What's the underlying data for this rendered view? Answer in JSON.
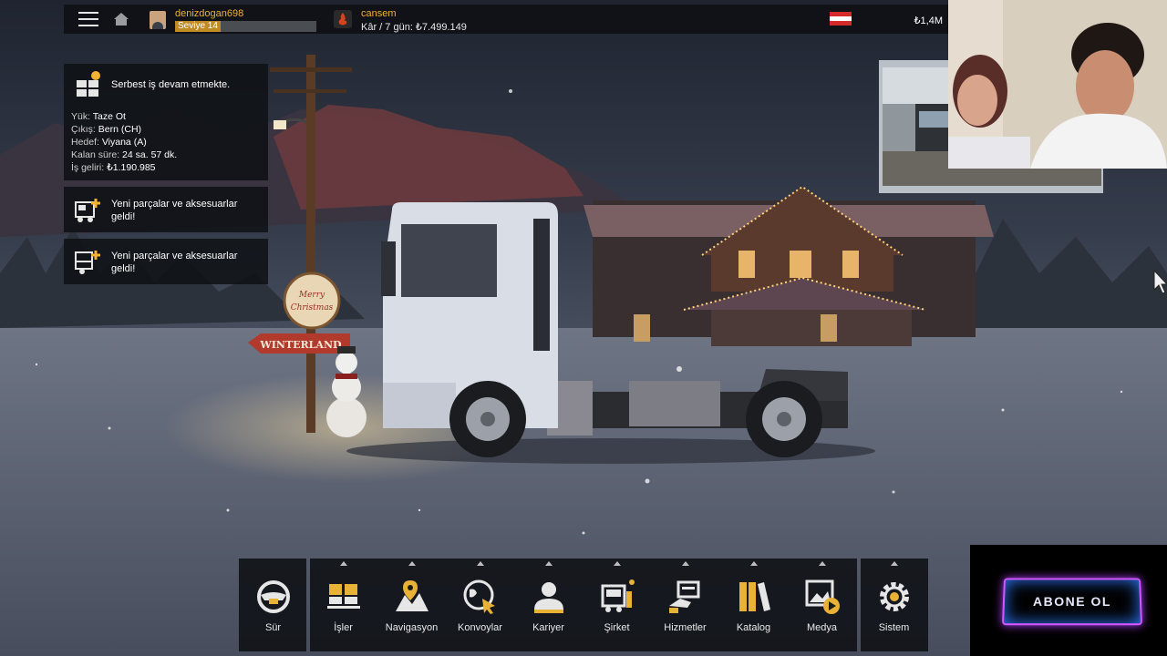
{
  "topbar": {
    "username": "denizdogan698",
    "level_label": "Seviye 14",
    "level_progress": 0.32,
    "company_name": "cansem",
    "company_profit": "Kâr / 7 gün: ₺7.499.149",
    "money": "₺1,4M"
  },
  "job": {
    "title": "Serbest iş devam etmekte.",
    "rows": [
      {
        "label": "Yük:",
        "value": "Taze Ot"
      },
      {
        "label": "Çıkış:",
        "value": "Bern (CH)"
      },
      {
        "label": "Hedef:",
        "value": "Viyana (A)"
      },
      {
        "label": "Kalan süre:",
        "value": "24 sa. 57 dk."
      },
      {
        "label": "İş geliri:",
        "value": "₺1.190.985"
      }
    ]
  },
  "notifications": [
    {
      "text": "Yeni parçalar ve aksesuarlar geldi!"
    },
    {
      "text": "Yeni parçalar ve aksesuarlar geldi!"
    }
  ],
  "scene_signs": {
    "sign_christmas": "Merry Christmas",
    "sign_winterland": "WINTERLAND"
  },
  "toolbar": {
    "items": [
      {
        "label": "Sür",
        "icon": "steering-wheel-icon"
      },
      {
        "label": "İşler",
        "icon": "jobs-icon"
      },
      {
        "label": "Navigasyon",
        "icon": "navigation-icon"
      },
      {
        "label": "Konvoylar",
        "icon": "convoys-icon"
      },
      {
        "label": "Kariyer",
        "icon": "career-icon"
      },
      {
        "label": "Şirket",
        "icon": "company-icon"
      },
      {
        "label": "Hizmetler",
        "icon": "services-icon"
      },
      {
        "label": "Katalog",
        "icon": "catalog-icon"
      },
      {
        "label": "Medya",
        "icon": "media-icon"
      },
      {
        "label": "Sistem",
        "icon": "settings-gear-icon"
      }
    ]
  },
  "subscribe": {
    "label": "ABONE OL"
  },
  "colors": {
    "accent": "#f2b233",
    "panel": "#0e1014",
    "level_fill": "#c08b22"
  }
}
